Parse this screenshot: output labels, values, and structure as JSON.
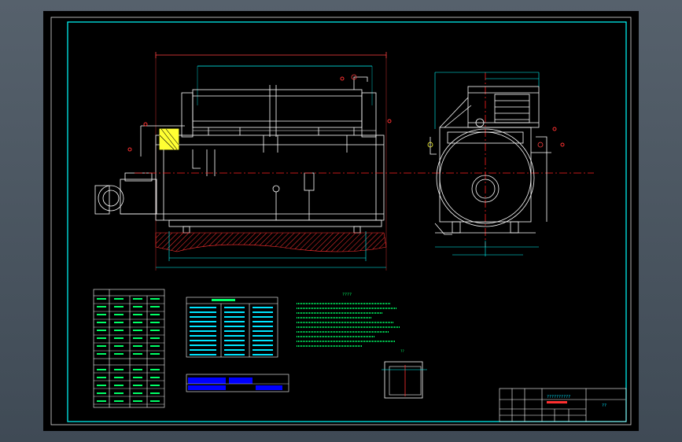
{
  "colors": {
    "background": "#000000",
    "frame": "#00ffff",
    "geometry": "#ffffff",
    "center_line": "#ff2020",
    "hatch": "#ff3030",
    "dimension": "#00ffff",
    "text_green": "#00ff66",
    "text_cyan": "#00e5ff",
    "fill_yellow": "#ffff33",
    "table_fill": "#0000ff"
  },
  "labels": {
    "notes_heading": "????",
    "section_mark": "??",
    "title_block_name": "??????????",
    "sheet_tag": "??"
  }
}
